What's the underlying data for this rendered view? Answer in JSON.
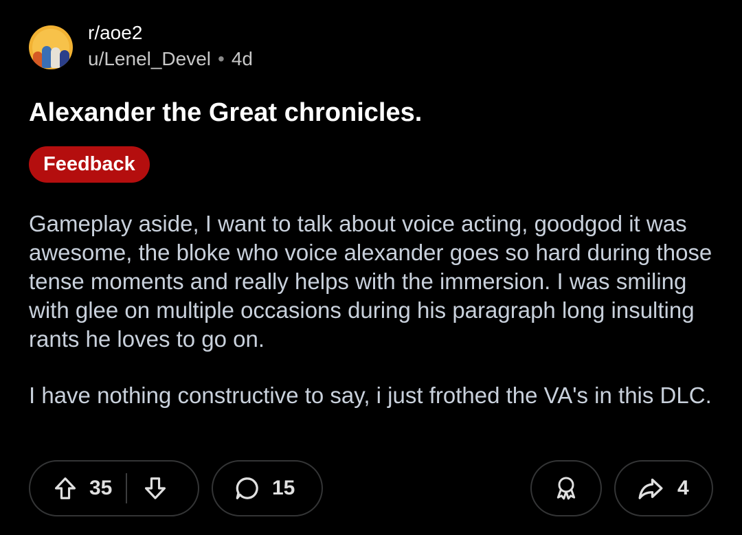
{
  "post": {
    "subreddit": "r/aoe2",
    "author": "u/Lenel_Devel",
    "separator": "•",
    "age": "4d",
    "title": "Alexander the Great chronicles.",
    "flair": "Feedback",
    "body": [
      "Gameplay aside, I want to talk about voice acting, goodgod it was awesome, the bloke who voice alexander goes so hard during those tense moments and really helps with the immersion. I was smiling with glee on multiple occasions during his paragraph long insulting rants he loves to go on.",
      "I have nothing constructive to say, i just frothed the VA's in this DLC."
    ]
  },
  "actions": {
    "upvotes": "35",
    "comments": "15",
    "shares": "4"
  },
  "icons": {
    "upvote": "arrow-up-icon",
    "downvote": "arrow-down-icon",
    "comments": "comment-bubble-icon",
    "award": "award-ribbon-icon",
    "share": "share-arrow-icon"
  },
  "colors": {
    "background": "#000000",
    "flair_bg": "#b40e0e",
    "body_text": "#c9d1dc",
    "pill_border": "#343536"
  }
}
